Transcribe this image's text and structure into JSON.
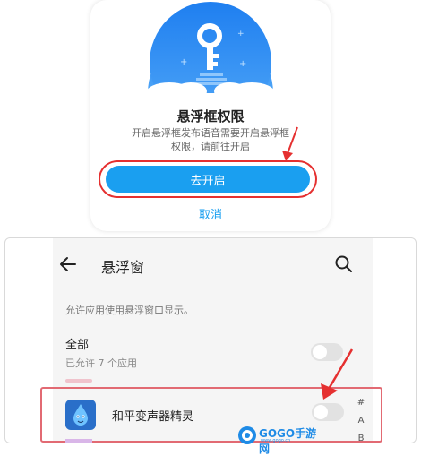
{
  "dialog": {
    "title": "悬浮框权限",
    "description": "开启悬浮框发布语音需要开启悬浮框\n权限，请前往开启",
    "primary_button": "去开启",
    "cancel_button": "取消"
  },
  "settings": {
    "header_title": "悬浮窗",
    "section_description": "允许应用使用悬浮窗口显示。",
    "all_label": "全部",
    "all_sublabel": "已允许 7 个应用",
    "all_toggle_on": false,
    "apps": [
      {
        "name": "和平变声器精灵",
        "toggle_on": false
      }
    ],
    "index_letters": [
      "#",
      "A",
      "B"
    ]
  },
  "watermark": {
    "text": "GOGO手游网",
    "subtext": "www.gogo.cn"
  },
  "colors": {
    "accent_blue": "#1a9ff0",
    "highlight_red": "#e53030",
    "toggle_off": "#e2e2e2"
  },
  "icons": {
    "back": "arrow-left-icon",
    "search": "search-icon",
    "illustration": "key-cloud-illustration",
    "app": "water-drop-app-icon"
  }
}
